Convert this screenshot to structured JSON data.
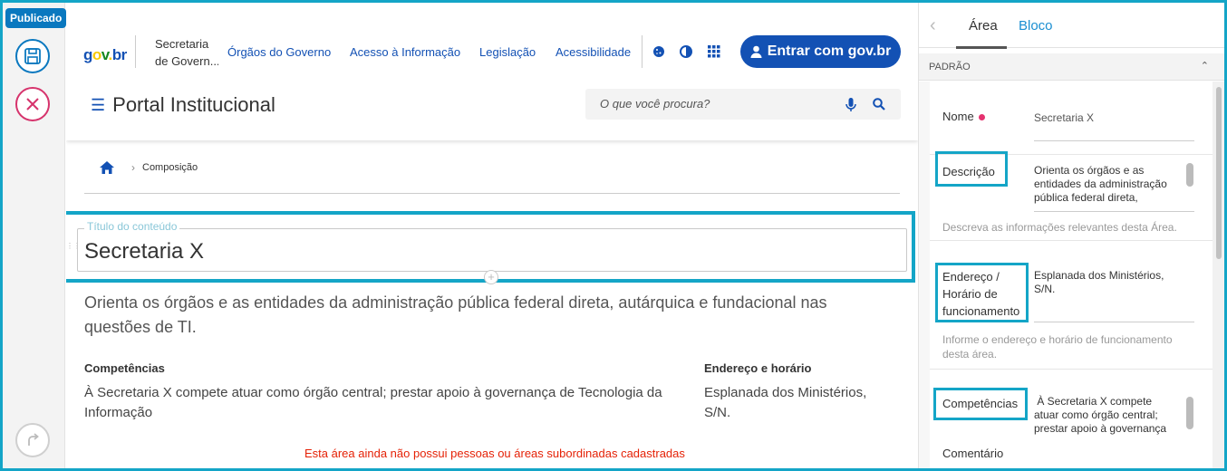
{
  "toolbar": {
    "status_badge": "Publicado"
  },
  "header": {
    "logo": "gov.br",
    "secretaria_line1": "Secretaria",
    "secretaria_line2": "de Govern...",
    "nav": [
      "Órgãos do Governo",
      "Acesso à Informação",
      "Legislação",
      "Acessibilidade"
    ],
    "login_label": "Entrar com gov.br",
    "portal_title": "Portal Institucional",
    "search_placeholder": "O que você procura?"
  },
  "breadcrumb": {
    "current": "Composição"
  },
  "content": {
    "title_legend": "Título do conteúdo",
    "title": "Secretaria X",
    "description": "Orienta os órgãos e as entidades da administração pública federal direta, autárquica e fundacional nas questões de TI.",
    "competencias_heading": "Competências",
    "competencias_text": "À Secretaria X compete atuar como órgão central; prestar apoio à governança de Tecnologia da Informação",
    "endereco_heading": "Endereço e horário",
    "endereco_text": "Esplanada dos Ministérios, S/N.",
    "notice": "Esta área ainda não possui pessoas ou áreas subordinadas cadastradas"
  },
  "panel": {
    "tabs": [
      "Área",
      "Bloco"
    ],
    "section": "PADRÃO",
    "nome_label": "Nome",
    "nome_value": "Secretaria X",
    "descricao_label": "Descrição",
    "descricao_value": "Orienta os órgãos e as entidades da administração pública federal direta,",
    "descricao_hint": "Descreva as informações relevantes desta Área.",
    "endereco_label": "Endereço / Horário de funcionamento",
    "endereco_value": "Esplanada dos Ministérios, S/N.",
    "endereco_hint": "Informe o endereço e horário de funcionamento desta área.",
    "competencias_label": "Competências",
    "competencias_value": " À Secretaria X compete atuar como órgão central; prestar apoio à governança",
    "comentario_label": "Comentário"
  },
  "colors": {
    "accent": "#14a5c7",
    "govbr_blue": "#1351b4",
    "link_blue": "#1a8ed1",
    "error_red": "#e52207"
  },
  "icons": [
    "save-icon",
    "close-icon",
    "redo-icon",
    "cookie-icon",
    "contrast-icon",
    "apps-grid-icon",
    "user-icon",
    "home-icon",
    "microphone-icon",
    "search-icon",
    "chevron-left-icon",
    "chevron-up-icon"
  ]
}
